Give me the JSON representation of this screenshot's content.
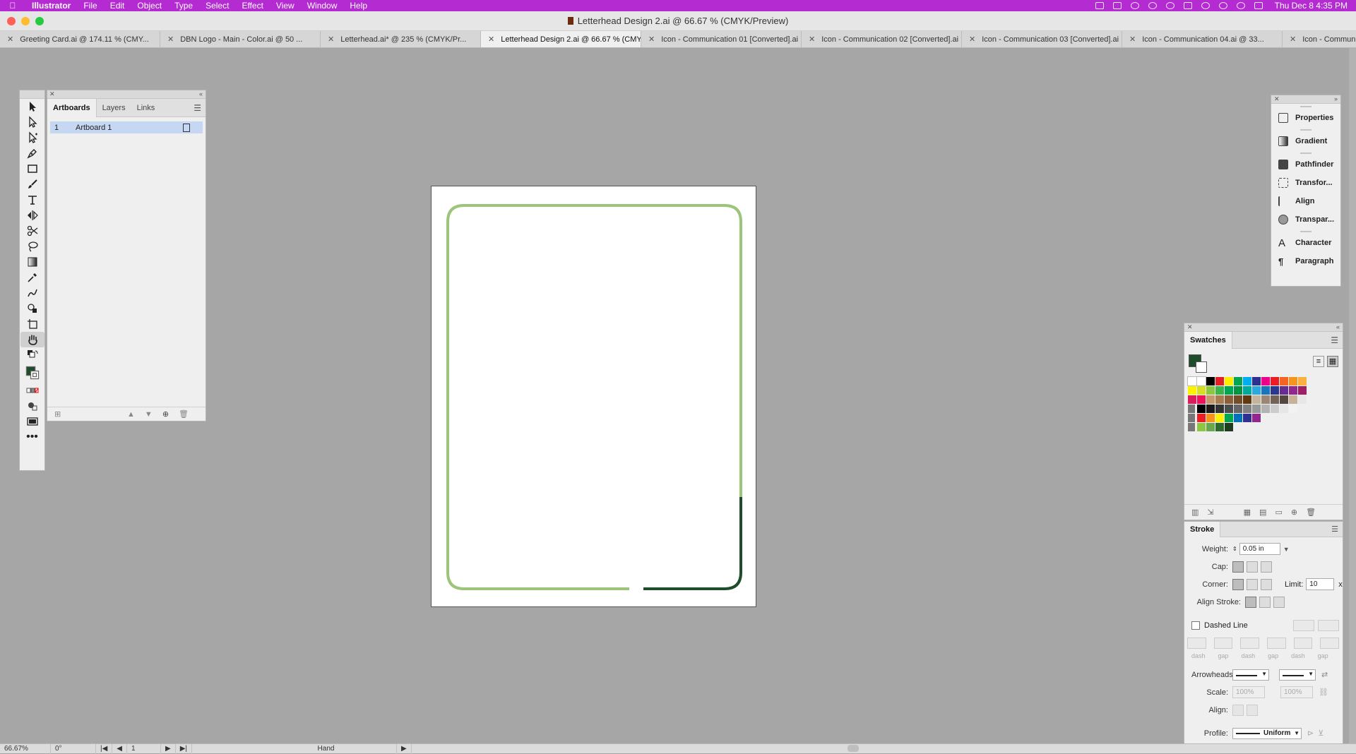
{
  "menubar": {
    "app": "Illustrator",
    "items": [
      "File",
      "Edit",
      "Object",
      "Type",
      "Select",
      "Effect",
      "View",
      "Window",
      "Help"
    ],
    "clock": "Thu Dec 8  4:35 PM"
  },
  "window": {
    "title": "Letterhead Design 2.ai @ 66.67 % (CMYK/Preview)"
  },
  "tabs": [
    {
      "label": "Greeting Card.ai @ 174.11 % (CMY..."
    },
    {
      "label": "DBN Logo - Main - Color.ai @ 50 ..."
    },
    {
      "label": "Letterhead.ai* @ 235 % (CMYK/Pr..."
    },
    {
      "label": "Letterhead Design 2.ai @ 66.67 % (CMYK/Preview)"
    },
    {
      "label": "Icon - Communication 01 [Converted].ai"
    },
    {
      "label": "Icon - Communication 02 [Converted].ai"
    },
    {
      "label": "Icon - Communication 03 [Converted].ai"
    },
    {
      "label": "Icon - Communication 04.ai @ 33..."
    },
    {
      "label": "Icon - Communicatio"
    }
  ],
  "artboards_panel": {
    "tabs": [
      "Artboards",
      "Layers",
      "Links"
    ],
    "rows": [
      {
        "num": "1",
        "name": "Artboard 1"
      }
    ]
  },
  "right_panel": {
    "items": [
      "Properties",
      "Gradient",
      "Pathfinder",
      "Transfor...",
      "Align",
      "Transpar...",
      "Character",
      "Paragraph"
    ]
  },
  "swatches": {
    "title": "Swatches",
    "rows": [
      [
        "#ffffff",
        "#ffffff",
        "#000000",
        "#e31e24",
        "#ffec00",
        "#00a651",
        "#00aeef",
        "#2e3192",
        "#ec008c",
        "#ed1c24",
        "#f26522",
        "#f7941d",
        "#fbb040"
      ],
      [
        "#fff200",
        "#d7df23",
        "#8dc63f",
        "#39b54a",
        "#00a651",
        "#009444",
        "#00a99d",
        "#27aae1",
        "#1c75bc",
        "#2b388f",
        "#662d91",
        "#92278f",
        "#9e1f63"
      ],
      [
        "#da1c5c",
        "#ed145b",
        "#c49a6c",
        "#a97c50",
        "#8b5e3c",
        "#754c29",
        "#603913",
        "#c2b59b",
        "#998675",
        "#736357",
        "#534741",
        "#c7b299",
        "#e6e7e8"
      ],
      [
        "#000000",
        "#1a1a1a",
        "#333333",
        "#4d4d4d",
        "#666666",
        "#808080",
        "#999999",
        "#b3b3b3",
        "#cccccc",
        "#e6e6e6",
        "#f2f2f2"
      ],
      [
        "#ed1c24",
        "#f7941d",
        "#fff200",
        "#00a651",
        "#0072bc",
        "#2e3192",
        "#92278f"
      ],
      [
        "#8dc63f",
        "#6aa84f",
        "#2d6a2d",
        "#1e3d1e"
      ]
    ]
  },
  "stroke": {
    "title": "Stroke",
    "weight_label": "Weight:",
    "weight": "0.05 in",
    "cap_label": "Cap:",
    "corner_label": "Corner:",
    "limit_label": "Limit:",
    "limit": "10",
    "limit_unit": "x",
    "align_label": "Align Stroke:",
    "dashed_label": "Dashed Line",
    "dash_labels": [
      "dash",
      "gap",
      "dash",
      "gap",
      "dash",
      "gap"
    ],
    "arrowheads_label": "Arrowheads:",
    "scale_label": "Scale:",
    "scale_a": "100%",
    "scale_b": "100%",
    "align2_label": "Align:",
    "profile_label": "Profile:",
    "profile": "Uniform"
  },
  "status": {
    "zoom": "66.67%",
    "rotation": "0°",
    "artboard": "1",
    "tool": "Hand"
  },
  "colors": {
    "menubar": "#b42bd1",
    "border_light": "#9dc47b",
    "border_dark": "#1e4d2b"
  }
}
